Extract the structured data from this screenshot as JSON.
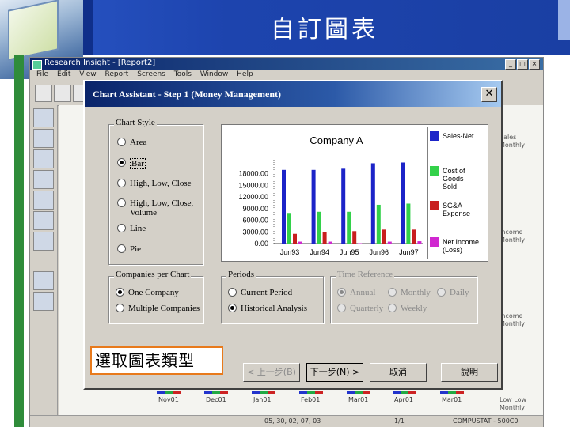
{
  "slide": {
    "title": "自訂圖表"
  },
  "app": {
    "title": "Research Insight - [Report2]",
    "menu": [
      "File",
      "Edit",
      "View",
      "Report",
      "Screens",
      "Tools",
      "Window",
      "Help"
    ],
    "status": [
      "05, 30, 02, 07, 03",
      "1/1",
      "COMPUSTAT - 500C0"
    ],
    "bottom_dates": [
      "Nov01",
      "Dec01",
      "Jan01",
      "Feb01",
      "Mar01",
      "Apr01",
      "Mar01"
    ],
    "bg_right_text": [
      "Sales",
      "Monthly",
      "Income",
      "Monthly",
      "Income",
      "Monthly",
      "Low Low",
      "Monthly"
    ]
  },
  "dialog": {
    "title": "Chart Assistant - Step 1    (Money Management)",
    "chart_style": {
      "label": "Chart Style",
      "options": [
        "Area",
        "Bar",
        "High, Low, Close",
        "High, Low, Close, Volume",
        "Line",
        "Pie"
      ],
      "selected": "Bar"
    },
    "companies": {
      "label": "Companies per Chart",
      "options": [
        "One Company",
        "Multiple Companies"
      ],
      "selected": "One Company"
    },
    "periods": {
      "label": "Periods",
      "options": [
        "Current Period",
        "Historical Analysis"
      ],
      "selected": "Historical Analysis"
    },
    "time_reference": {
      "label": "Time Reference",
      "options": [
        "Annual",
        "Monthly",
        "Daily",
        "Quarterly",
        "Weekly"
      ],
      "selected": "Annual"
    },
    "buttons": {
      "back": "< 上一步(B)",
      "next": "下一步(N) >",
      "cancel": "取消",
      "help": "說明"
    }
  },
  "caption": "選取圖表類型",
  "colors": {
    "sales": "#1c24c8",
    "cogs": "#33d14a",
    "sga": "#c81e1e",
    "net_income": "#d028d0"
  },
  "chart_data": {
    "type": "bar",
    "title": "Company A",
    "categories": [
      "Jun93",
      "Jun94",
      "Jun95",
      "Jun96",
      "Jun97"
    ],
    "series": [
      {
        "name": "Sales-Net",
        "values": [
          19000,
          19000,
          19300,
          20700,
          20900
        ]
      },
      {
        "name": "Cost of Goods Sold",
        "values": [
          7900,
          8200,
          8200,
          10000,
          10300
        ]
      },
      {
        "name": "SG&A Expense",
        "values": [
          2500,
          3000,
          3200,
          3600,
          3600
        ]
      },
      {
        "name": "Net Income (Loss)",
        "values": [
          500,
          500,
          100,
          500,
          600
        ]
      }
    ],
    "ytick_labels": [
      "0.00",
      "3000.00",
      "6000.00",
      "9000.00",
      "12000.00",
      "15000.00",
      "18000.00"
    ],
    "ylim": [
      0,
      21000
    ],
    "legend": "right"
  }
}
